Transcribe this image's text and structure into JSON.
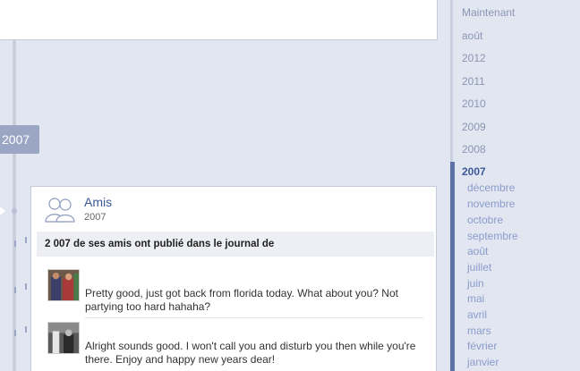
{
  "timeline": {
    "year_marker": "2007"
  },
  "post": {
    "title": "Amis",
    "subtitle": "2007",
    "header": "2 007 de ses amis ont publié dans le journal de",
    "stories": [
      {
        "message": "Pretty good, just got back from florida today. What about you? Not partying too hard hahaha?"
      },
      {
        "message": "Alright sounds good. I won't call you and disturb you then while you're there. Enjoy and happy new years dear!"
      }
    ]
  },
  "year_nav": {
    "items": [
      "Maintenant",
      "août",
      "2012",
      "2011",
      "2010",
      "2009",
      "2008"
    ],
    "active_year": "2007",
    "months": [
      "décembre",
      "novembre",
      "octobre",
      "septembre",
      "août",
      "juillet",
      "juin",
      "mai",
      "avril",
      "mars",
      "février",
      "janvier"
    ]
  },
  "colors": {
    "background": "#e2e6f0",
    "link": "#3b5998",
    "nav_inactive": "#8a96b4",
    "nav_month": "#8a9ccc",
    "year_marker_bg": "#9aa6c4"
  },
  "icons": {
    "friends": "friends-icon"
  }
}
